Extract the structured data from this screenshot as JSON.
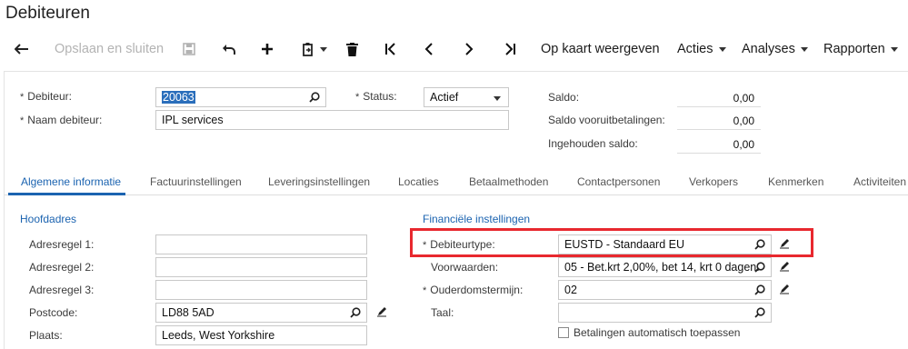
{
  "page": {
    "title": "Debiteuren"
  },
  "toolbar": {
    "save_close_label": "Opslaan en sluiten",
    "map_label": "Op kaart weergeven",
    "actions_label": "Acties",
    "analyses_label": "Analyses",
    "reports_label": "Rapporten"
  },
  "header": {
    "customer_label": "Debiteur:",
    "customer_value": "20063",
    "name_label": "Naam debiteur:",
    "name_value": "IPL services",
    "status_label": "Status:",
    "status_value": "Actief",
    "balance_label": "Saldo:",
    "balance_value": "0,00",
    "prepay_label": "Saldo vooruitbetalingen:",
    "prepay_value": "0,00",
    "retained_label": "Ingehouden saldo:",
    "retained_value": "0,00"
  },
  "tabs": [
    {
      "label": "Algemene informatie",
      "active": true
    },
    {
      "label": "Factuurinstellingen"
    },
    {
      "label": "Leveringsinstellingen"
    },
    {
      "label": "Locaties"
    },
    {
      "label": "Betaalmethoden"
    },
    {
      "label": "Contactpersonen"
    },
    {
      "label": "Verkopers"
    },
    {
      "label": "Kenmerken"
    },
    {
      "label": "Activiteiten"
    }
  ],
  "address": {
    "section_title": "Hoofdadres",
    "line1_label": "Adresregel 1:",
    "line1_value": "",
    "line2_label": "Adresregel 2:",
    "line2_value": "",
    "line3_label": "Adresregel 3:",
    "line3_value": "",
    "postcode_label": "Postcode:",
    "postcode_value": "LD88 5AD",
    "city_label": "Plaats:",
    "city_value": "Leeds, West Yorkshire"
  },
  "financial": {
    "section_title": "Financiële instellingen",
    "type_label": "Debiteurtype:",
    "type_value": "EUSTD - Standaard EU",
    "terms_label": "Voorwaarden:",
    "terms_value": "05 - Bet.krt 2,00%, bet 14, krt 0 dagen.",
    "aging_label": "Ouderdomstermijn:",
    "aging_value": "02",
    "language_label": "Taal:",
    "language_value": "",
    "auto_apply_label": "Betalingen automatisch toepassen"
  },
  "colors": {
    "accent": "#1b63b0",
    "highlight": "#e8282e",
    "selection": "#2a6ebb"
  },
  "icons": [
    "back-arrow-icon",
    "save-icon",
    "undo-icon",
    "plus-icon",
    "copy-paste-icon",
    "trash-icon",
    "first-icon",
    "previous-icon",
    "next-icon",
    "last-icon",
    "search-icon",
    "pencil-icon"
  ]
}
